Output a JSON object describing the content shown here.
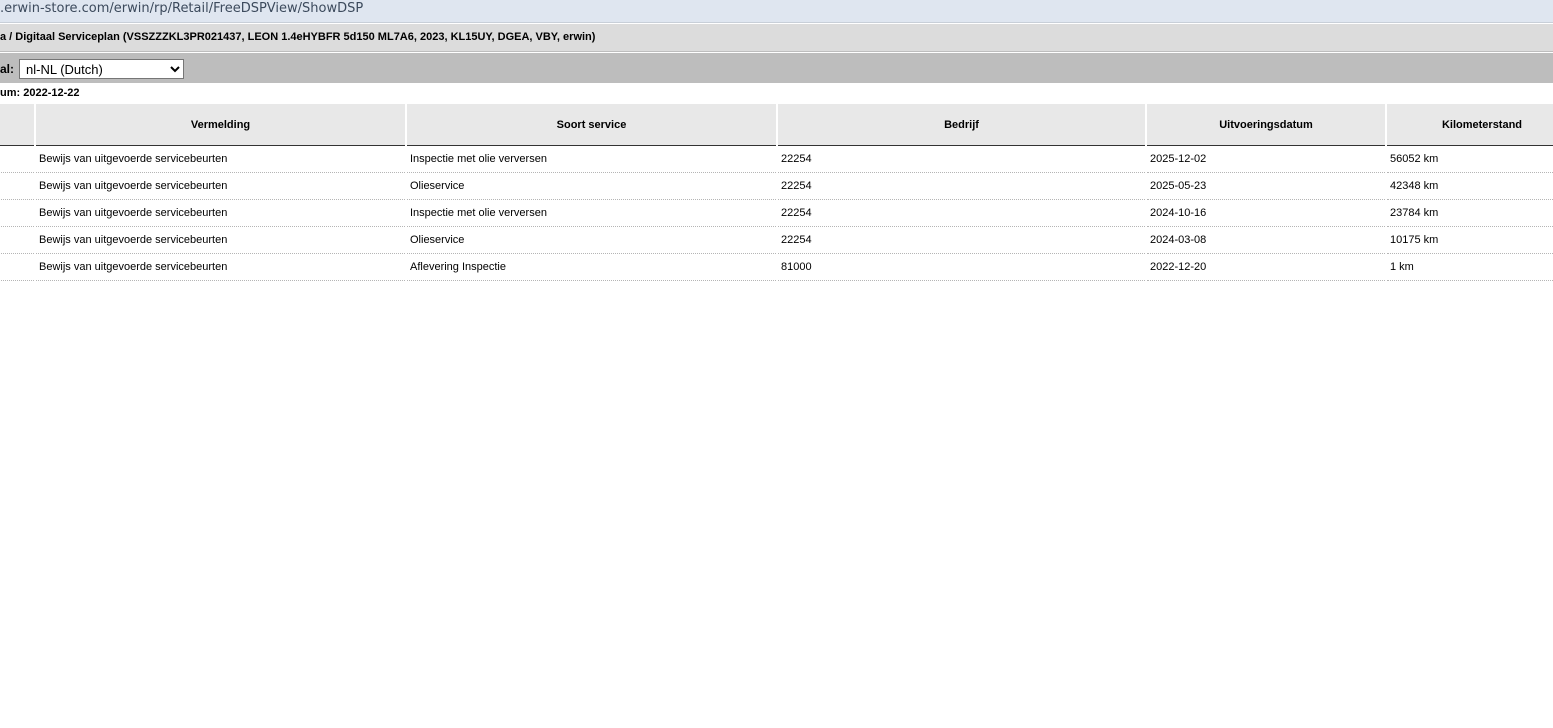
{
  "browser": {
    "url": ".erwin-store.com/erwin/rp/Retail/FreeDSPView/ShowDSP"
  },
  "header": {
    "title": "a / Digitaal Serviceplan (VSSZZZKL3PR021437, LEON 1.4eHYBFR 5d150 ML7A6, 2023, KL15UY, DGEA, VBY, erwin)"
  },
  "language": {
    "label": "al:",
    "selected": "nl-NL (Dutch)"
  },
  "date_line": "um: 2022-12-22",
  "table": {
    "columns": [
      "",
      "Vermelding",
      "Soort service",
      "Bedrijf",
      "Uitvoeringsdatum",
      "Kilometerstand"
    ],
    "rows": [
      {
        "vermelding": "Bewijs van uitgevoerde servicebeurten",
        "soort": "Inspectie met olie verversen",
        "bedrijf": "22254",
        "datum": "2025-12-02",
        "km": "56052 km"
      },
      {
        "vermelding": "Bewijs van uitgevoerde servicebeurten",
        "soort": "Olieservice",
        "bedrijf": "22254",
        "datum": "2025-05-23",
        "km": "42348 km"
      },
      {
        "vermelding": "Bewijs van uitgevoerde servicebeurten",
        "soort": "Inspectie met olie verversen",
        "bedrijf": "22254",
        "datum": "2024-10-16",
        "km": "23784 km"
      },
      {
        "vermelding": "Bewijs van uitgevoerde servicebeurten",
        "soort": "Olieservice",
        "bedrijf": "22254",
        "datum": "2024-03-08",
        "km": "10175 km"
      },
      {
        "vermelding": "Bewijs van uitgevoerde servicebeurten",
        "soort": "Aflevering Inspectie",
        "bedrijf": "81000",
        "datum": "2022-12-20",
        "km": "1 km"
      }
    ]
  }
}
